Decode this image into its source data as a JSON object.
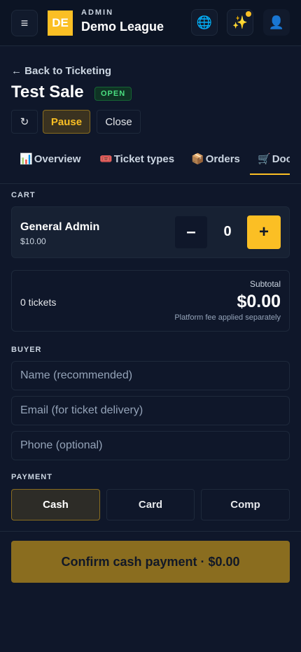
{
  "header": {
    "menu_icon": "≡",
    "logo_text": "DE",
    "kicker": "ADMIN",
    "brand_name": "Demo League",
    "globe_icon": "🌐",
    "sparkle_icon": "✨",
    "user_icon": "👤",
    "accent": "#fbbf24"
  },
  "page": {
    "back_label": "← Back to Ticketing",
    "title": "Test Sale",
    "status": "OPEN",
    "refresh_icon": "↻",
    "pause_label": "Pause",
    "close_label": "Close"
  },
  "tabs": [
    {
      "icon": "📊",
      "label": "Overview"
    },
    {
      "icon": "🎟️",
      "label": "Ticket types"
    },
    {
      "icon": "📦",
      "label": "Orders"
    },
    {
      "icon": "🛒",
      "label": "Door"
    }
  ],
  "cart": {
    "section_label": "CART",
    "item_name": "General Admin",
    "item_price": "$10.00",
    "minus_label": "–",
    "quantity": "0",
    "plus_label": "+"
  },
  "summary": {
    "ticket_count": "0 tickets",
    "subtotal_label": "Subtotal",
    "subtotal_value": "$0.00",
    "fee_note": "Platform fee applied separately"
  },
  "buyer": {
    "section_label": "BUYER",
    "name_placeholder": "Name (recommended)",
    "email_placeholder": "Email (for ticket delivery)",
    "phone_placeholder": "Phone (optional)"
  },
  "payment": {
    "section_label": "PAYMENT",
    "options": [
      "Cash",
      "Card",
      "Comp"
    ],
    "selected": "Cash"
  },
  "confirm": {
    "label": "Confirm cash payment · $0.00"
  }
}
